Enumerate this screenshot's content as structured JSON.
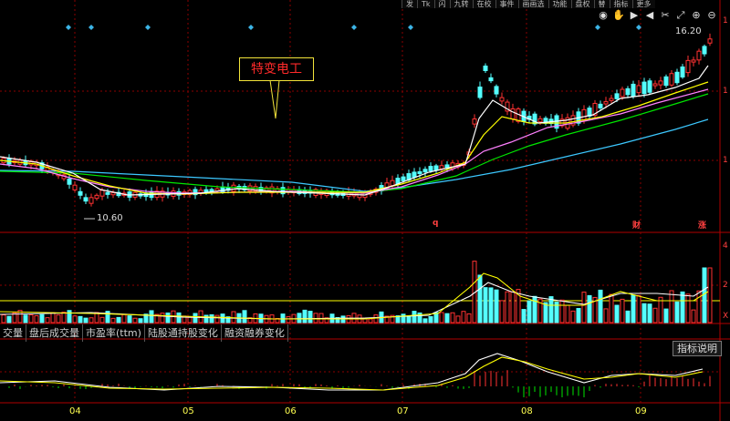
{
  "top_toolbar": [
    "发",
    "Tk",
    "闪",
    "九转",
    "在校",
    "事件",
    "画画选",
    "功能",
    "盘权",
    "替",
    "指标",
    "更多"
  ],
  "stock_name": "特变电工",
  "prices": {
    "high_label": "16.20",
    "low_label": "10.60"
  },
  "markers": {
    "q": "q",
    "cai": "财",
    "zhang": "涨"
  },
  "right_axis_labels": [
    "1",
    "1",
    "1",
    "4",
    "2",
    "X"
  ],
  "indicator_tabs": [
    "交量",
    "盘后成交量",
    "市盈率(ttm)",
    "陆股通持股变化",
    "融资融券变化"
  ],
  "help_button": "指标说明",
  "months": [
    "04",
    "05",
    "06",
    "07",
    "08",
    "09"
  ],
  "toolbar_icons": [
    "eye-icon",
    "hand-icon",
    "play-icon",
    "rewind-icon",
    "scissors-icon",
    "expand-icon",
    "zoom-in-icon",
    "zoom-out-icon"
  ],
  "colors": {
    "up": "#ff3232",
    "down": "#54ffff",
    "ma5": "#ffffff",
    "ma10": "#ffff00",
    "ma20": "#ff80ff",
    "ma30": "#00e600",
    "ma60": "#3cc8ff",
    "grid": "#8b0000"
  }
}
